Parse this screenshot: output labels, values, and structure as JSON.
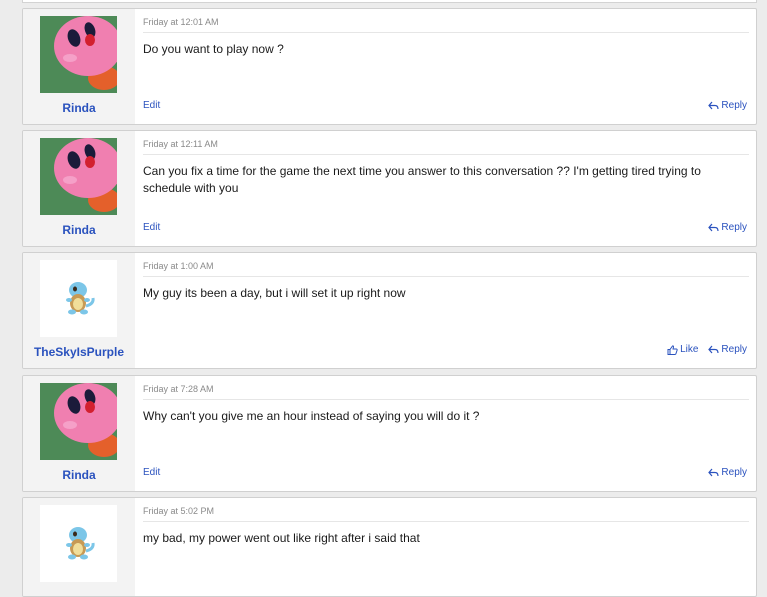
{
  "messages": [
    {
      "username": "Rinda",
      "date": "Friday at 12:01 AM",
      "text": "Do you want to play now ?",
      "edit_label": "Edit",
      "reply_label": "Reply"
    },
    {
      "username": "Rinda",
      "date": "Friday at 12:11 AM",
      "text": "Can you fix a time for the game the next time you answer to this conversation ?? I'm getting tired trying to schedule with you",
      "edit_label": "Edit",
      "reply_label": "Reply"
    },
    {
      "username": "TheSkyIsPurple",
      "date": "Friday at 1:00 AM",
      "text": "My guy its been a day, but i will set it up right now",
      "like_label": "Like",
      "reply_label": "Reply"
    },
    {
      "username": "Rinda",
      "date": "Friday at 7:28 AM",
      "text": "Why can't you give me an hour instead of saying you will do it ?",
      "edit_label": "Edit",
      "reply_label": "Reply"
    },
    {
      "username": "TheSkyIsPurple",
      "date": "Friday at 5:02 PM",
      "text": "my bad, my power went out like right after i said that"
    }
  ],
  "colors": {
    "link": "#2a52be",
    "kirby_pink": "#f07fb0",
    "avatar_green_bg": "#4d8a57"
  },
  "icons": {
    "avatar_rinda": "kirby-avatar",
    "avatar_sky": "squirtle-avatar",
    "reply": "reply-arrow-icon",
    "like": "thumbs-up-icon"
  }
}
